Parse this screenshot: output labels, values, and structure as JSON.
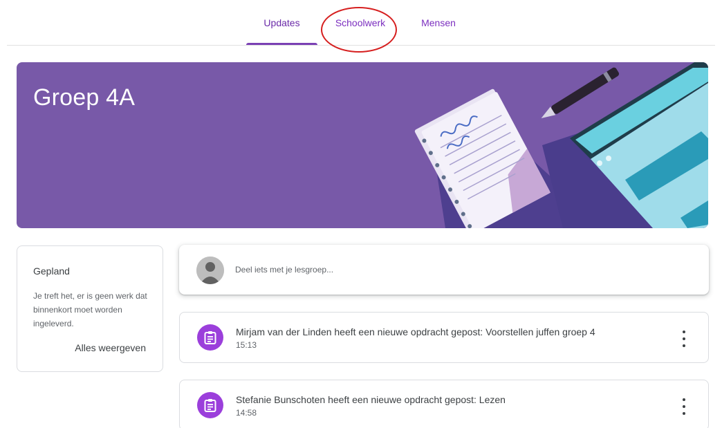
{
  "tabs": [
    {
      "label": "Updates",
      "active": true
    },
    {
      "label": "Schoolwerk",
      "active": false
    },
    {
      "label": "Mensen",
      "active": false
    }
  ],
  "banner": {
    "title": "Groep 4A",
    "color": "#7859a8"
  },
  "upcoming": {
    "title": "Gepland",
    "message": "Je treft het, er is geen werk dat binnenkort moet worden ingeleverd.",
    "view_all": "Alles weergeven"
  },
  "share": {
    "placeholder": "Deel iets met je lesgroep..."
  },
  "posts": [
    {
      "title": "Mirjam van der Linden heeft een nieuwe opdracht gepost: Voorstellen juffen groep 4",
      "time": "15:13",
      "icon": "assignment-icon"
    },
    {
      "title": "Stefanie Bunschoten heeft een nieuwe opdracht gepost: Lezen",
      "time": "14:58",
      "icon": "assignment-icon"
    }
  ],
  "colors": {
    "accent": "#7a40b4",
    "assignment": "#9b3fdb",
    "annotation": "#d61f1f"
  }
}
